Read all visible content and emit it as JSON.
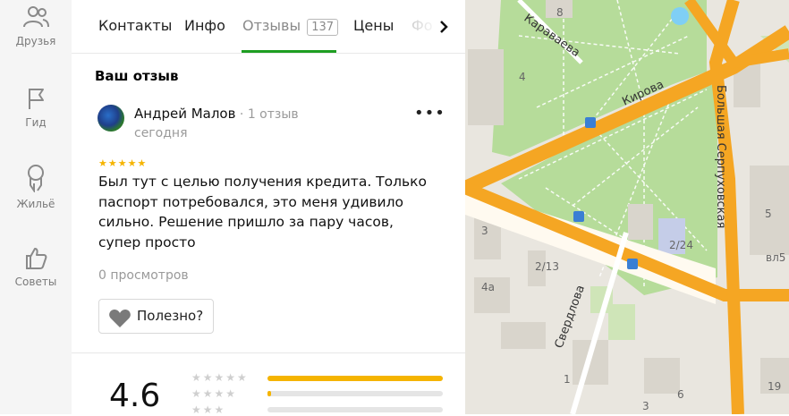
{
  "sidebar": {
    "items": [
      {
        "label": "Друзья",
        "icon": "friends-icon"
      },
      {
        "label": "Гид",
        "icon": "flag-icon"
      },
      {
        "label": "Жильё",
        "icon": "home-pin-icon"
      },
      {
        "label": "Советы",
        "icon": "thumbs-up-icon"
      }
    ]
  },
  "tabs": {
    "items": [
      "Контакты",
      "Инфо",
      "Отзывы",
      "Цены",
      "Фо"
    ],
    "reviews_count": "137",
    "active": "Отзывы",
    "next_icon": "chevron-right-icon"
  },
  "review": {
    "section_title": "Ваш отзыв",
    "author": "Андрей Малов",
    "author_reviews": "1 отзыв",
    "date": "сегодня",
    "stars": 5,
    "stars_text": "★★★★★",
    "text": "Был тут с целью получения кредита. Только паспорт потребовался, это меня удивило сильно. Решение пришло за пару часов, супер просто",
    "views": "0 просмотров",
    "helpful_label": "Полезно?",
    "more_icon": "more-horizontal-icon"
  },
  "summary": {
    "rating": "4.6",
    "distribution": [
      {
        "stars": "★★★★★",
        "fraction": 1.0
      },
      {
        "stars": "★★★★",
        "fraction": 0.02
      },
      {
        "stars": "★★★",
        "fraction": 0.0
      }
    ]
  },
  "map": {
    "street_labels": [
      "Караваева",
      "Кирова",
      "Большая Серпуховская",
      "Свердлова"
    ],
    "house_numbers": [
      "8",
      "4",
      "3",
      "2/13",
      "4а",
      "2/24",
      "5",
      "вл5",
      "6",
      "19",
      "3",
      "1"
    ],
    "colors": {
      "road": "#f5a623",
      "park": "#b6dc9a",
      "building": "#d9d5cc",
      "water": "#7fcff5"
    }
  },
  "colors": {
    "accent_green": "#1e9e22",
    "star_yellow": "#f5b400"
  }
}
